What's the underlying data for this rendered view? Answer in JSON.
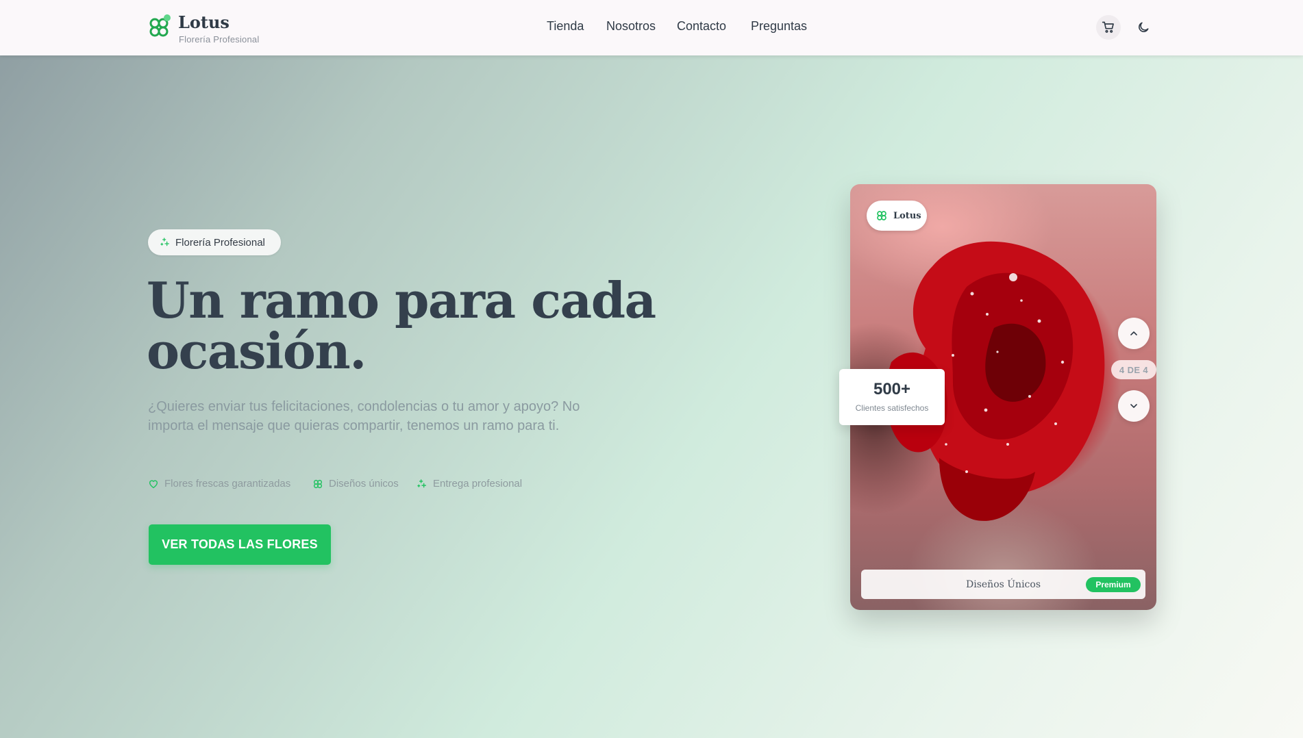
{
  "brand": {
    "name": "Lotus",
    "tagline": "Florería Profesional"
  },
  "nav": {
    "items": [
      {
        "label": "Tienda"
      },
      {
        "label": "Nosotros"
      },
      {
        "label": "Contacto"
      },
      {
        "label": "Preguntas"
      }
    ]
  },
  "header_actions": {
    "cart_icon": "cart-icon",
    "theme_icon": "moon-icon"
  },
  "hero": {
    "badge": "Florería Profesional",
    "title_line1": "Un ramo para cada",
    "title_line2": "ocasión.",
    "description": "¿Quieres enviar tus felicitaciones, condolencias o tu amor y apoyo? No importa el mensaje que quieras compartir, tenemos un ramo para ti.",
    "features": [
      {
        "icon": "heart-icon",
        "label": "Flores frescas garantizadas"
      },
      {
        "icon": "flower-icon",
        "label": "Diseños únicos"
      },
      {
        "icon": "sparkle-icon",
        "label": "Entrega profesional"
      }
    ],
    "cta_label": "VER TODAS LAS FLORES"
  },
  "showcase": {
    "badge_label": "Lotus",
    "stat_value": "500+",
    "stat_label": "Clientes satisfechos",
    "slide_counter": "4 DE 4",
    "caption": "Diseños Únicos",
    "tag": "Premium"
  },
  "colors": {
    "accent": "#22c261",
    "text_dark": "#34404d",
    "muted": "#8a9aa0",
    "rose": "#c20b17"
  }
}
